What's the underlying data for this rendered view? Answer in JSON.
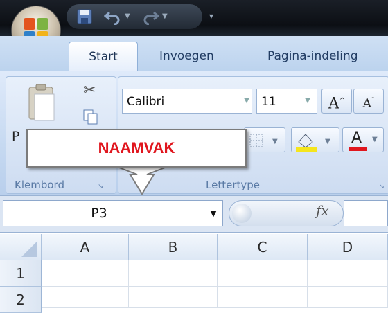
{
  "quick_access": {
    "icons": [
      "save-icon",
      "undo-icon",
      "redo-icon",
      "customize-icon"
    ]
  },
  "tabs": [
    {
      "label": "Start",
      "active": true
    },
    {
      "label": "Invoegen",
      "active": false
    },
    {
      "label": "Pagina-indeling",
      "active": false
    }
  ],
  "ribbon": {
    "clipboard": {
      "label": "Klembord",
      "paste_partial": "P"
    },
    "font": {
      "label": "Lettertype",
      "font_name": "Calibri",
      "font_size": "11",
      "grow_label": "A",
      "shrink_label": "A",
      "font_color_label": "A"
    }
  },
  "callout": {
    "text": "NAAMVAK"
  },
  "formula_bar": {
    "name_box": "P3",
    "fx_label": "fx"
  },
  "grid": {
    "columns": [
      "A",
      "B",
      "C",
      "D"
    ],
    "rows": [
      "1",
      "2"
    ]
  },
  "colors": {
    "callout_text": "#e0161e",
    "fill_yellow": "#f5e51c",
    "font_red": "#e0161e"
  }
}
